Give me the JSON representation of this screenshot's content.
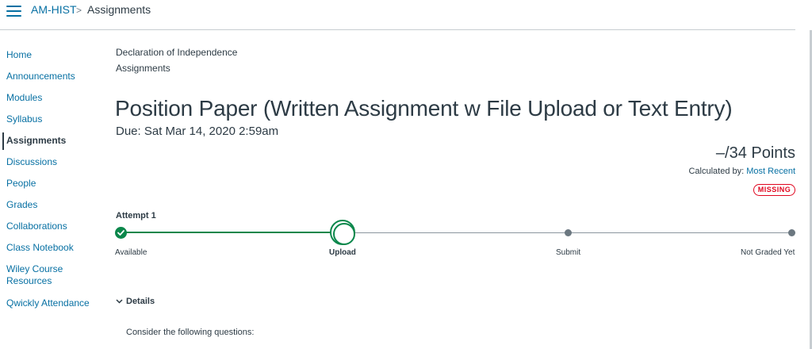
{
  "header": {
    "course": "AM-HIST",
    "separator": ">",
    "current": "Assignments"
  },
  "sidebar": {
    "items": [
      {
        "label": "Home"
      },
      {
        "label": "Announcements"
      },
      {
        "label": "Modules"
      },
      {
        "label": "Syllabus"
      },
      {
        "label": "Assignments",
        "active": true
      },
      {
        "label": "Discussions"
      },
      {
        "label": "People"
      },
      {
        "label": "Grades"
      },
      {
        "label": "Collaborations"
      },
      {
        "label": "Class Notebook"
      },
      {
        "label": "Wiley Course Resources"
      },
      {
        "label": "Qwickly Attendance"
      }
    ]
  },
  "breadcrumb_links": [
    "Declaration of Independence",
    "Assignments"
  ],
  "assignment": {
    "title": "Position Paper (Written Assignment w File Upload or Text Entry)",
    "due": "Due: Sat Mar 14, 2020 2:59am",
    "points": "–/34 Points",
    "calculated_label": "Calculated by:",
    "calculated_value": "Most Recent",
    "status": "MISSING"
  },
  "stepper": {
    "attempt": "Attempt 1",
    "steps": [
      {
        "label": "Available",
        "state": "done"
      },
      {
        "label": "Upload",
        "state": "current"
      },
      {
        "label": "Submit",
        "state": "pending"
      },
      {
        "label": "Not Graded Yet",
        "state": "pending"
      }
    ]
  },
  "details": {
    "label": "Details",
    "body": "Consider the following questions:"
  },
  "colors": {
    "link": "#0770a3",
    "text": "#2d3b45",
    "success": "#0b874b",
    "danger": "#e0061f"
  },
  "icons": {
    "menu": "hamburger-icon",
    "chevron": "chevron-down-icon",
    "check": "checkmark-icon"
  }
}
